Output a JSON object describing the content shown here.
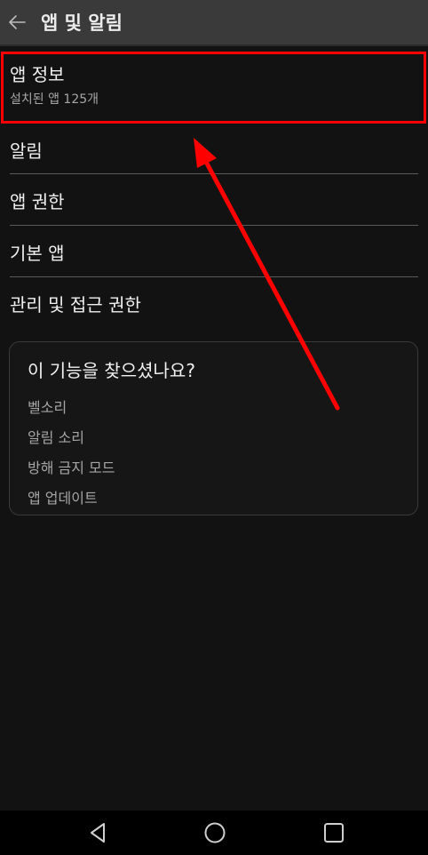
{
  "header": {
    "title": "앱 및 알림",
    "back_icon": "arrow-left-icon"
  },
  "menu": {
    "app_info": {
      "label": "앱 정보",
      "subtitle": "설치된 앱 125개"
    },
    "notifications": {
      "label": "알림"
    },
    "app_permissions": {
      "label": "앱 권한"
    },
    "default_apps": {
      "label": "기본 앱"
    },
    "special_access": {
      "label": "관리 및 접근 권한"
    }
  },
  "suggestions": {
    "title": "이 기능을 찾으셨나요?",
    "items": [
      "벨소리",
      "알림 소리",
      "방해 금지 모드",
      "앱 업데이트"
    ]
  },
  "annotation": {
    "highlight_color": "#ff0000",
    "arrow_color": "#ff0000"
  },
  "navbar": {
    "back_icon": "triangle-back-icon",
    "home_icon": "circle-home-icon",
    "recents_icon": "square-recents-icon"
  },
  "colors": {
    "background": "#121212",
    "appbar": "#3a3a3a",
    "primary_text": "#f0f0f0",
    "secondary_text": "#a6a6a6"
  }
}
